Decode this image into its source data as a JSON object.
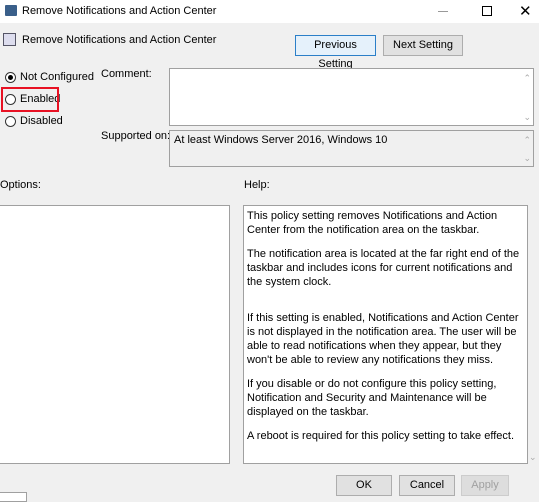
{
  "window": {
    "title": "Remove Notifications and Action Center",
    "controls": [
      "minimize",
      "maximize",
      "close"
    ]
  },
  "header": {
    "title": "Remove Notifications and Action Center",
    "prev_label": "Previous Setting",
    "next_label": "Next Setting"
  },
  "state": {
    "options": [
      {
        "label": "Not Configured",
        "selected": true
      },
      {
        "label": "Enabled",
        "selected": false,
        "highlighted": true
      },
      {
        "label": "Disabled",
        "selected": false
      }
    ],
    "highlight_color": "#e81123"
  },
  "comment": {
    "label": "Comment:",
    "value": ""
  },
  "supported": {
    "label": "Supported on:",
    "value": "At least Windows Server 2016, Windows 10"
  },
  "options_label": "Options:",
  "help_label": "Help:",
  "help": [
    "This policy setting removes Notifications and Action Center from the notification area on the taskbar.",
    "The notification area is located at the far right end of the taskbar and includes icons for current notifications and the system clock.",
    "If this setting is enabled, Notifications and Action Center is not displayed in the notification area. The user will be able to read notifications when they appear, but they won't be able to review any notifications they miss.",
    "If you disable or do not configure this policy setting, Notification and Security and Maintenance will be displayed on the taskbar.",
    "A reboot is required for this policy setting to take effect."
  ],
  "footer": {
    "ok": "OK",
    "cancel": "Cancel",
    "apply": "Apply"
  }
}
